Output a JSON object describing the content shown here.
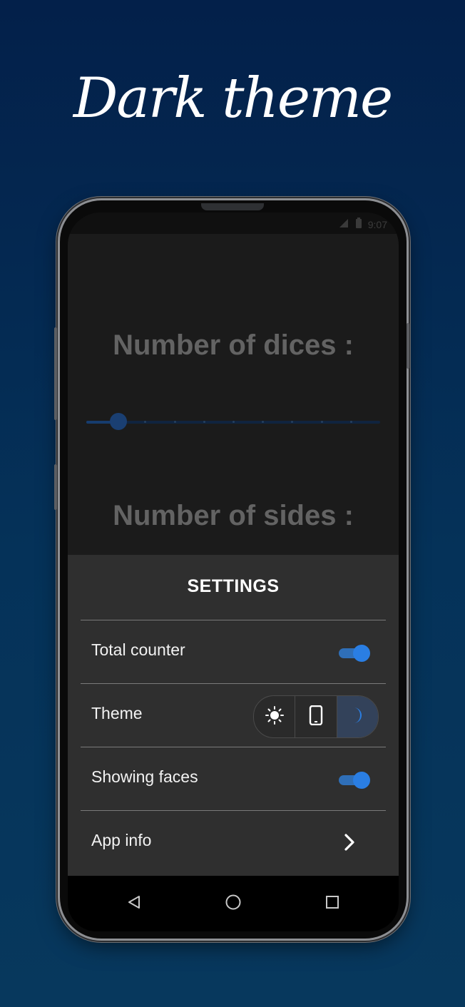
{
  "headline": "Dark theme",
  "status_bar": {
    "signal_icon": "signal-icon",
    "battery_icon": "battery-icon",
    "time": "9:07"
  },
  "app": {
    "dices_label": "Number of dices :",
    "sides_label": "Number of sides :",
    "dices_slider": {
      "value_fraction": 0.11,
      "ticks": 10
    }
  },
  "settings": {
    "title": "SETTINGS",
    "total_counter": {
      "label": "Total counter",
      "enabled": true
    },
    "theme": {
      "label": "Theme",
      "options": [
        "light-theme-sun-icon",
        "system-theme-phone-icon",
        "dark-theme-moon-icon"
      ],
      "selected": "dark"
    },
    "showing_faces": {
      "label": "Showing faces",
      "enabled": true
    },
    "app_info": {
      "label": "App info",
      "icon": "chevron-right-icon"
    }
  },
  "navigation": [
    "back-icon",
    "home-icon",
    "recents-icon"
  ],
  "colors": {
    "background_top": "#03204a",
    "background_bottom": "#07385d",
    "accent": "#2a7ee3",
    "sheet": "#2f2f2f"
  }
}
